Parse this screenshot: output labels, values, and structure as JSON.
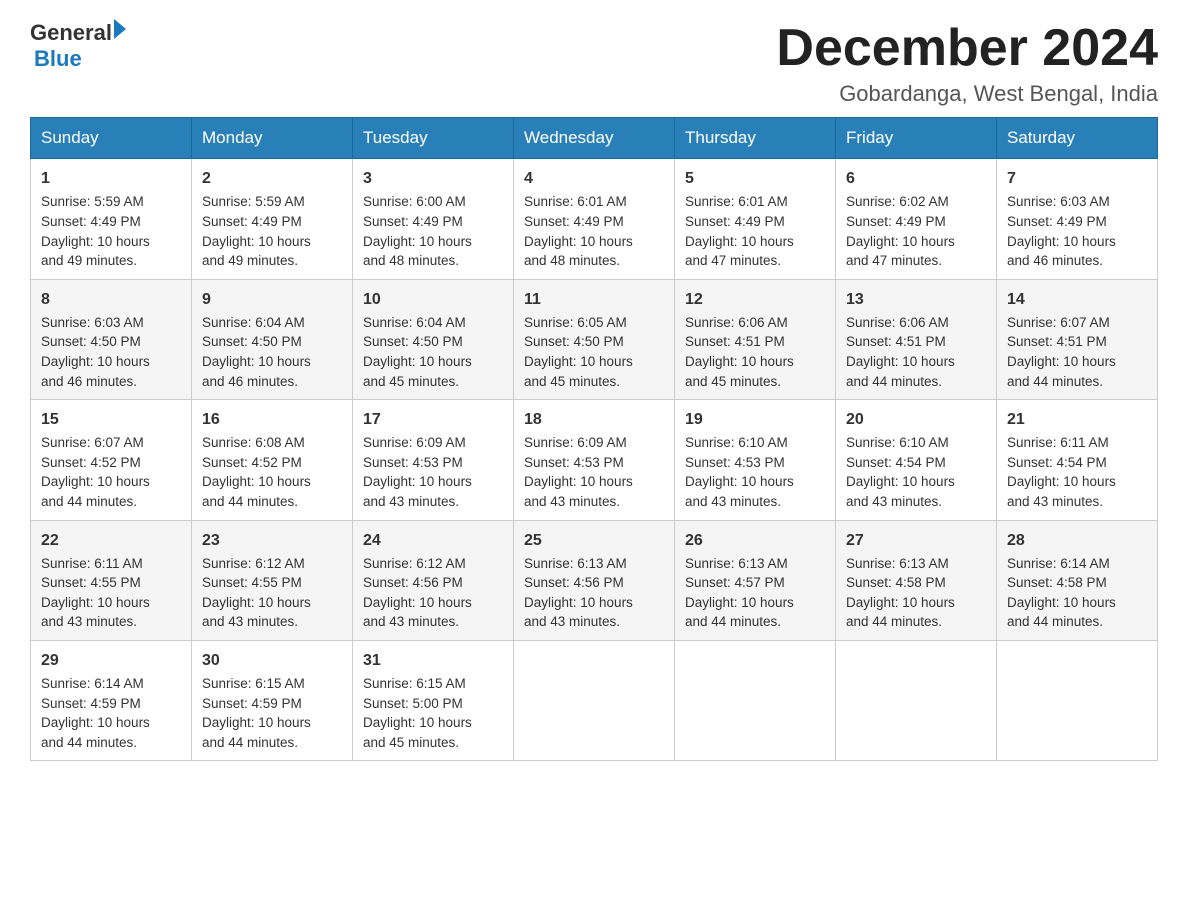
{
  "header": {
    "logo_general": "General",
    "logo_blue": "Blue",
    "month_title": "December 2024",
    "location": "Gobardanga, West Bengal, India"
  },
  "days_of_week": [
    "Sunday",
    "Monday",
    "Tuesday",
    "Wednesday",
    "Thursday",
    "Friday",
    "Saturday"
  ],
  "weeks": [
    [
      {
        "day": "1",
        "sunrise": "5:59 AM",
        "sunset": "4:49 PM",
        "daylight": "10 hours and 49 minutes."
      },
      {
        "day": "2",
        "sunrise": "5:59 AM",
        "sunset": "4:49 PM",
        "daylight": "10 hours and 49 minutes."
      },
      {
        "day": "3",
        "sunrise": "6:00 AM",
        "sunset": "4:49 PM",
        "daylight": "10 hours and 48 minutes."
      },
      {
        "day": "4",
        "sunrise": "6:01 AM",
        "sunset": "4:49 PM",
        "daylight": "10 hours and 48 minutes."
      },
      {
        "day": "5",
        "sunrise": "6:01 AM",
        "sunset": "4:49 PM",
        "daylight": "10 hours and 47 minutes."
      },
      {
        "day": "6",
        "sunrise": "6:02 AM",
        "sunset": "4:49 PM",
        "daylight": "10 hours and 47 minutes."
      },
      {
        "day": "7",
        "sunrise": "6:03 AM",
        "sunset": "4:49 PM",
        "daylight": "10 hours and 46 minutes."
      }
    ],
    [
      {
        "day": "8",
        "sunrise": "6:03 AM",
        "sunset": "4:50 PM",
        "daylight": "10 hours and 46 minutes."
      },
      {
        "day": "9",
        "sunrise": "6:04 AM",
        "sunset": "4:50 PM",
        "daylight": "10 hours and 46 minutes."
      },
      {
        "day": "10",
        "sunrise": "6:04 AM",
        "sunset": "4:50 PM",
        "daylight": "10 hours and 45 minutes."
      },
      {
        "day": "11",
        "sunrise": "6:05 AM",
        "sunset": "4:50 PM",
        "daylight": "10 hours and 45 minutes."
      },
      {
        "day": "12",
        "sunrise": "6:06 AM",
        "sunset": "4:51 PM",
        "daylight": "10 hours and 45 minutes."
      },
      {
        "day": "13",
        "sunrise": "6:06 AM",
        "sunset": "4:51 PM",
        "daylight": "10 hours and 44 minutes."
      },
      {
        "day": "14",
        "sunrise": "6:07 AM",
        "sunset": "4:51 PM",
        "daylight": "10 hours and 44 minutes."
      }
    ],
    [
      {
        "day": "15",
        "sunrise": "6:07 AM",
        "sunset": "4:52 PM",
        "daylight": "10 hours and 44 minutes."
      },
      {
        "day": "16",
        "sunrise": "6:08 AM",
        "sunset": "4:52 PM",
        "daylight": "10 hours and 44 minutes."
      },
      {
        "day": "17",
        "sunrise": "6:09 AM",
        "sunset": "4:53 PM",
        "daylight": "10 hours and 43 minutes."
      },
      {
        "day": "18",
        "sunrise": "6:09 AM",
        "sunset": "4:53 PM",
        "daylight": "10 hours and 43 minutes."
      },
      {
        "day": "19",
        "sunrise": "6:10 AM",
        "sunset": "4:53 PM",
        "daylight": "10 hours and 43 minutes."
      },
      {
        "day": "20",
        "sunrise": "6:10 AM",
        "sunset": "4:54 PM",
        "daylight": "10 hours and 43 minutes."
      },
      {
        "day": "21",
        "sunrise": "6:11 AM",
        "sunset": "4:54 PM",
        "daylight": "10 hours and 43 minutes."
      }
    ],
    [
      {
        "day": "22",
        "sunrise": "6:11 AM",
        "sunset": "4:55 PM",
        "daylight": "10 hours and 43 minutes."
      },
      {
        "day": "23",
        "sunrise": "6:12 AM",
        "sunset": "4:55 PM",
        "daylight": "10 hours and 43 minutes."
      },
      {
        "day": "24",
        "sunrise": "6:12 AM",
        "sunset": "4:56 PM",
        "daylight": "10 hours and 43 minutes."
      },
      {
        "day": "25",
        "sunrise": "6:13 AM",
        "sunset": "4:56 PM",
        "daylight": "10 hours and 43 minutes."
      },
      {
        "day": "26",
        "sunrise": "6:13 AM",
        "sunset": "4:57 PM",
        "daylight": "10 hours and 44 minutes."
      },
      {
        "day": "27",
        "sunrise": "6:13 AM",
        "sunset": "4:58 PM",
        "daylight": "10 hours and 44 minutes."
      },
      {
        "day": "28",
        "sunrise": "6:14 AM",
        "sunset": "4:58 PM",
        "daylight": "10 hours and 44 minutes."
      }
    ],
    [
      {
        "day": "29",
        "sunrise": "6:14 AM",
        "sunset": "4:59 PM",
        "daylight": "10 hours and 44 minutes."
      },
      {
        "day": "30",
        "sunrise": "6:15 AM",
        "sunset": "4:59 PM",
        "daylight": "10 hours and 44 minutes."
      },
      {
        "day": "31",
        "sunrise": "6:15 AM",
        "sunset": "5:00 PM",
        "daylight": "10 hours and 45 minutes."
      },
      null,
      null,
      null,
      null
    ]
  ],
  "labels": {
    "sunrise": "Sunrise:",
    "sunset": "Sunset:",
    "daylight": "Daylight:"
  }
}
